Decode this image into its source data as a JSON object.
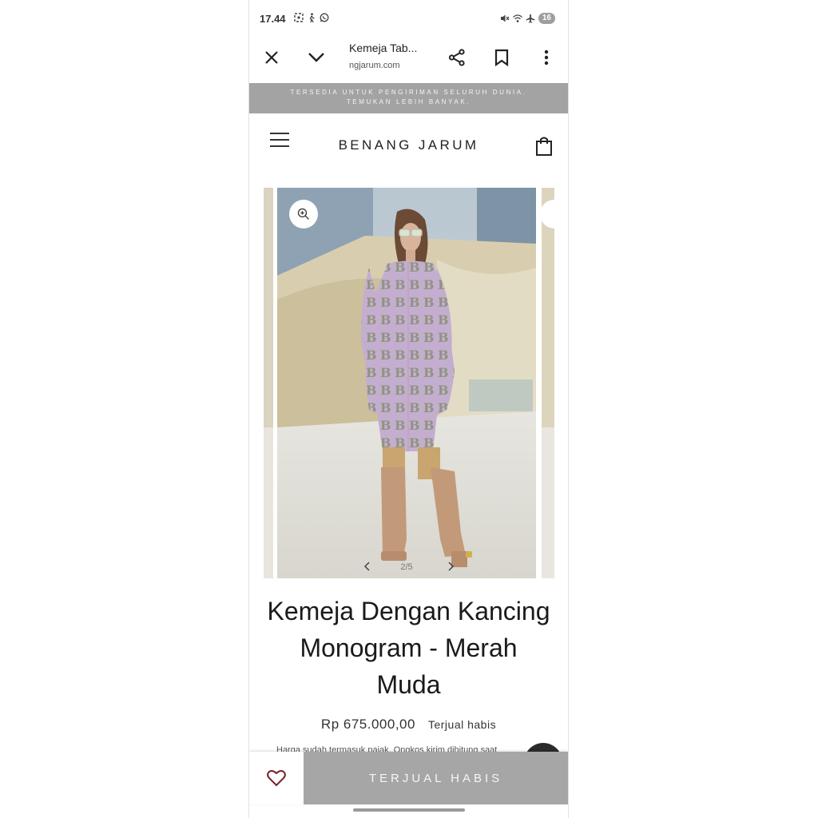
{
  "status_bar": {
    "time": "17.44",
    "battery": "16"
  },
  "browser": {
    "tab_title": "Kemeja Tab...",
    "url": "ngjarum.com"
  },
  "announcement": {
    "line1": "TERSEDIA UNTUK PENGIRIMAN SELURUH DUNIA.",
    "line2": "TEMUKAN LEBIH BANYAK."
  },
  "store": {
    "brand": "BENANG JARUM"
  },
  "gallery": {
    "counter": "2/5"
  },
  "product": {
    "title": "Kemeja Dengan Kancing Monogram - Merah Muda",
    "price": "Rp 675.000,00",
    "availability": "Terjual habis",
    "tax_note": "Harga sudah termasuk pajak. Ongkos kirim dihitung saat"
  },
  "bottom_bar": {
    "sold_out_button": "TERJUAL HABIS"
  },
  "colors": {
    "announcement_bg": "#a3a3a3",
    "sold_out_bg": "#a6a6a6",
    "wishlist_icon": "#7a1f2b"
  }
}
